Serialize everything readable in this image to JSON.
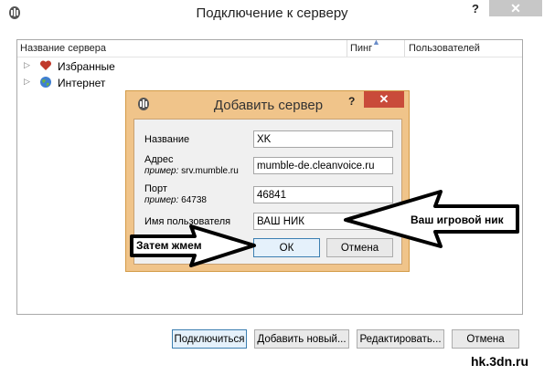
{
  "window": {
    "title": "Подключение к серверу",
    "help_label": "?",
    "close_label": "✕"
  },
  "server_list": {
    "columns": [
      "Название сервера",
      "Пинг",
      "Пользователей"
    ],
    "rows": [
      {
        "label": "Избранные",
        "icon": "heart-icon"
      },
      {
        "label": "Интернет",
        "icon": "globe-icon"
      }
    ]
  },
  "footer_buttons": {
    "connect": "Подключиться",
    "add_new": "Добавить новый...",
    "edit": "Редактировать...",
    "cancel": "Отмена"
  },
  "dialog": {
    "title": "Добавить сервер",
    "help_label": "?",
    "close_label": "✕",
    "fields": {
      "name": {
        "label": "Название",
        "value": "XK"
      },
      "address": {
        "label": "Адрес",
        "hint_prefix": "пример:",
        "hint": "srv.mumble.ru",
        "value": "mumble-de.cleanvoice.ru"
      },
      "port": {
        "label": "Порт",
        "hint_prefix": "пример:",
        "hint": "64738",
        "value": "46841"
      },
      "username": {
        "label": "Имя пользователя",
        "value": "ВАШ НИК"
      }
    },
    "ok_label": "ОК",
    "cancel_label": "Отмена"
  },
  "annotations": {
    "nick_note": "Ваш игровой ник",
    "press_note": "Затем жмем"
  },
  "watermark": "hk.3dn.ru",
  "colors": {
    "dialog_frame": "#f0c48a",
    "dialog_close": "#c94b3a",
    "default_button_border": "#3c7fb1"
  }
}
